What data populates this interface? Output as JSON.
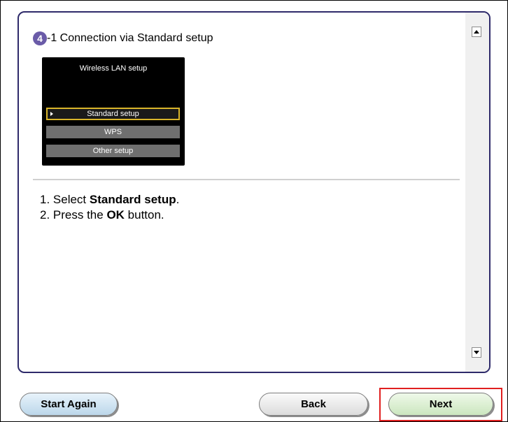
{
  "step": {
    "number": "4",
    "title": "-1 Connection via Standard setup"
  },
  "printer_screen": {
    "title": "Wireless LAN setup",
    "options": [
      "Standard setup",
      "WPS",
      "Other setup"
    ],
    "selected": "Standard setup"
  },
  "instructions": [
    {
      "prefix": "1. Select ",
      "bold": "Standard setup",
      "suffix": "."
    },
    {
      "prefix": "2. Press the ",
      "bold": "OK",
      "suffix": " button."
    }
  ],
  "buttons": {
    "start_again": "Start Again",
    "back": "Back",
    "next": "Next"
  },
  "colors": {
    "panel_border": "#2e2a6a",
    "badge": "#6a5ba8",
    "highlight": "#e01f1f",
    "lcd_selection": "#d9b52b"
  },
  "icons": {
    "scroll_up": "triangle-up",
    "scroll_down": "triangle-down"
  }
}
